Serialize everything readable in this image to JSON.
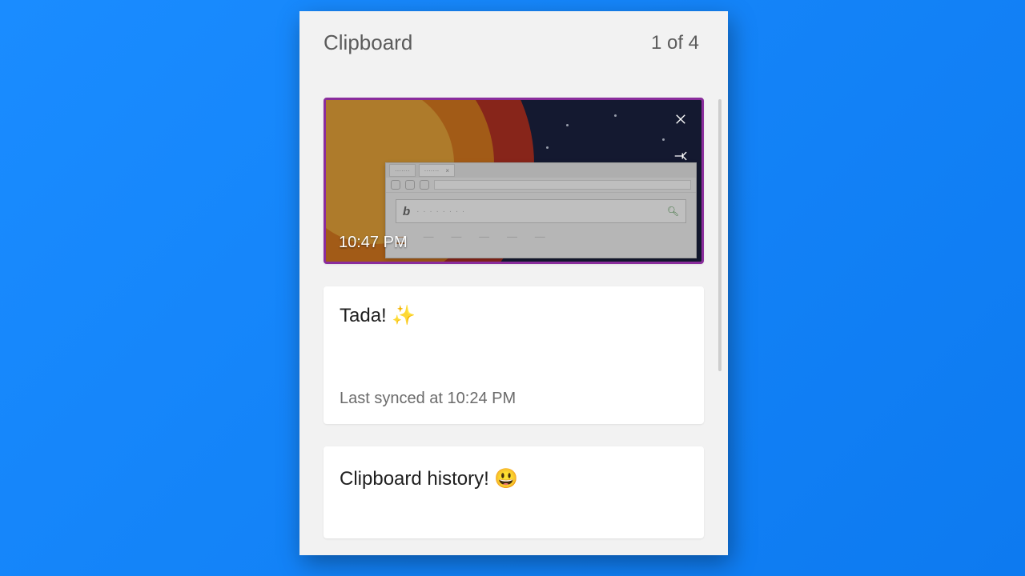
{
  "header": {
    "title": "Clipboard",
    "counter": "1 of 4"
  },
  "items": [
    {
      "type": "image",
      "timestamp": "10:47 PM",
      "close_icon": "close-icon",
      "pin_icon": "pin-icon"
    },
    {
      "type": "text",
      "content": "Tada! ✨",
      "subtext": "Last synced at 10:24 PM"
    },
    {
      "type": "text",
      "content": "Clipboard history! 😃"
    }
  ]
}
